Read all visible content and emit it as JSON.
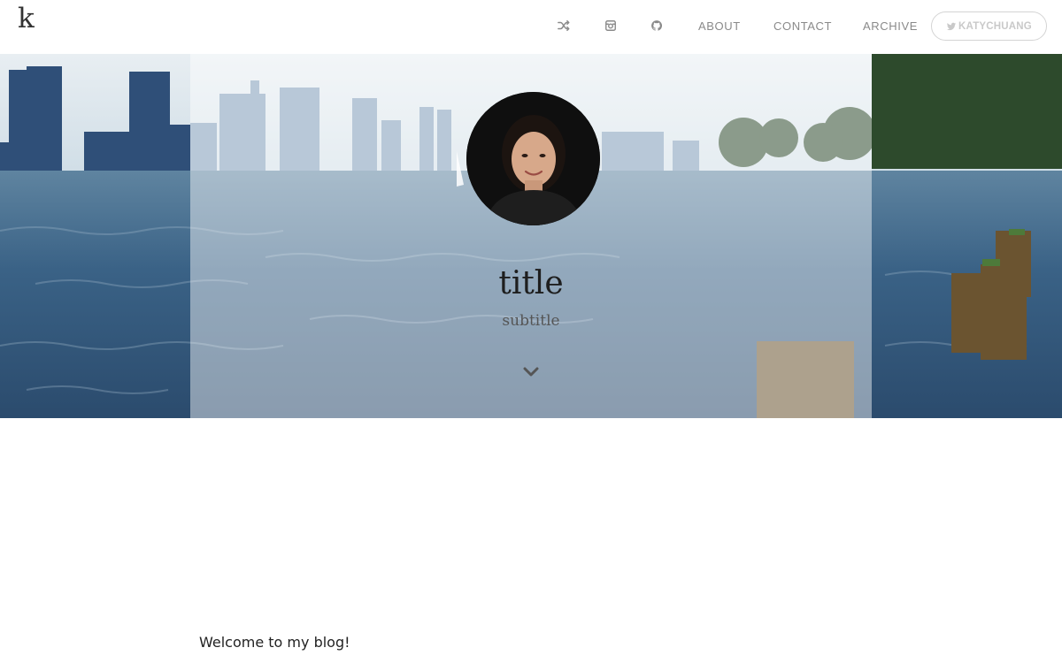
{
  "nav": {
    "logo": "k",
    "icons": [
      "shuffle-icon",
      "instagram-icon",
      "github-icon"
    ],
    "links": [
      "ABOUT",
      "CONTACT",
      "ARCHIVE"
    ],
    "twitter_label": "KATYCHUANG"
  },
  "hero": {
    "title": "title",
    "subtitle": "subtitle",
    "scroll_icon": "chevron-down-icon"
  },
  "content": {
    "welcome": "Welcome to my blog!"
  },
  "colors": {
    "text": "#222222",
    "nav_text": "#8a8a8a",
    "button_border": "#d4d4d4"
  }
}
